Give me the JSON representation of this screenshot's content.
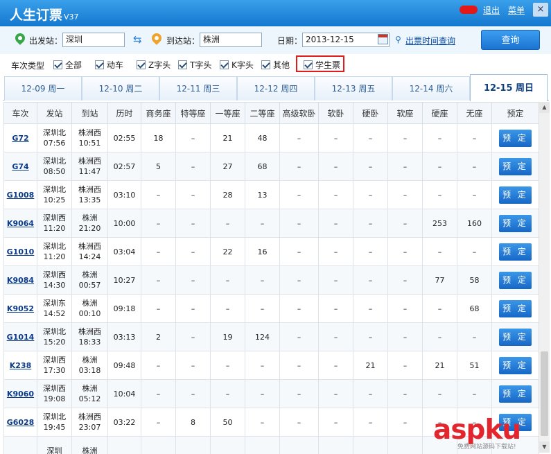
{
  "app": {
    "title": "人生订票",
    "version": "V37"
  },
  "titlebar": {
    "logout": "退出",
    "menu": "菜单",
    "close": "×"
  },
  "search": {
    "from_label": "出发站：",
    "from_value": "深圳",
    "to_label": "到达站：",
    "to_value": "株洲",
    "date_label": "日期：",
    "date_value": "2013-12-15",
    "schedule_link": "出票时间查询",
    "query_button": "查询"
  },
  "filters": {
    "label": "车次类型",
    "items": [
      "全部",
      "动车",
      "Z字头",
      "T字头",
      "K字头",
      "其他",
      "学生票"
    ]
  },
  "date_tabs": [
    "12-09 周一",
    "12-10 周二",
    "12-11 周三",
    "12-12 周四",
    "12-13 周五",
    "12-14 周六",
    "12-15 周日"
  ],
  "active_tab": 6,
  "table": {
    "headers": [
      "车次",
      "发站",
      "到站",
      "历时",
      "商务座",
      "特等座",
      "一等座",
      "二等座",
      "高级软卧",
      "软卧",
      "硬卧",
      "软座",
      "硬座",
      "无座",
      "预定"
    ],
    "book_label": "预 定",
    "rows": [
      [
        "G72",
        "深圳北",
        "07:56",
        "株洲西",
        "10:51",
        "02:55",
        "18",
        "–",
        "21",
        "48",
        "–",
        "–",
        "–",
        "–",
        "–",
        "–"
      ],
      [
        "G74",
        "深圳北",
        "08:50",
        "株洲西",
        "11:47",
        "02:57",
        "5",
        "–",
        "27",
        "68",
        "–",
        "–",
        "–",
        "–",
        "–",
        "–"
      ],
      [
        "G1008",
        "深圳北",
        "10:25",
        "株洲西",
        "13:35",
        "03:10",
        "–",
        "–",
        "28",
        "13",
        "–",
        "–",
        "–",
        "–",
        "–",
        "–"
      ],
      [
        "K9064",
        "深圳西",
        "11:20",
        "株洲",
        "21:20",
        "10:00",
        "–",
        "–",
        "–",
        "–",
        "–",
        "–",
        "–",
        "–",
        "253",
        "160"
      ],
      [
        "G1010",
        "深圳北",
        "11:20",
        "株洲西",
        "14:24",
        "03:04",
        "–",
        "–",
        "22",
        "16",
        "–",
        "–",
        "–",
        "–",
        "–",
        "–"
      ],
      [
        "K9084",
        "深圳西",
        "14:30",
        "株洲",
        "00:57",
        "10:27",
        "–",
        "–",
        "–",
        "–",
        "–",
        "–",
        "–",
        "–",
        "77",
        "58"
      ],
      [
        "K9052",
        "深圳东",
        "14:52",
        "株洲",
        "00:10",
        "09:18",
        "–",
        "–",
        "–",
        "–",
        "–",
        "–",
        "–",
        "–",
        "–",
        "68"
      ],
      [
        "G1014",
        "深圳北",
        "15:20",
        "株洲西",
        "18:33",
        "03:13",
        "2",
        "–",
        "19",
        "124",
        "–",
        "–",
        "–",
        "–",
        "–",
        "–"
      ],
      [
        "K238",
        "深圳西",
        "17:30",
        "株洲",
        "03:18",
        "09:48",
        "–",
        "–",
        "–",
        "–",
        "–",
        "–",
        "21",
        "–",
        "21",
        "51"
      ],
      [
        "K9060",
        "深圳西",
        "19:08",
        "株洲",
        "05:12",
        "10:04",
        "–",
        "–",
        "–",
        "–",
        "–",
        "–",
        "–",
        "–",
        "–",
        "–"
      ],
      [
        "G6028",
        "深圳北",
        "19:45",
        "株洲西",
        "23:07",
        "03:22",
        "–",
        "8",
        "50",
        "–",
        "–",
        "–",
        "–",
        "–",
        "–",
        "–"
      ],
      [
        "",
        "深圳",
        "",
        "株洲",
        "",
        "",
        "",
        "",
        "",
        "",
        "",
        "",
        "",
        "",
        "",
        ""
      ]
    ]
  },
  "watermark": {
    "text": "aspku",
    "sub": "免费网站源码下载站!"
  },
  "colors": {
    "titlebar": "#1e86dc",
    "highlight": "#e01c1c",
    "seat_count": "#1e8a1e",
    "button": "#1f78d6"
  }
}
